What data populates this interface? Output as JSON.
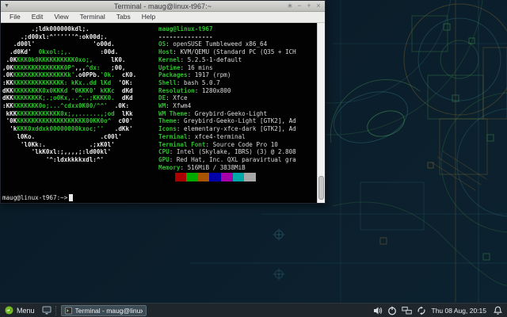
{
  "window": {
    "title": "Terminal - maug@linux-t967:~",
    "menu_items": [
      "File",
      "Edit",
      "View",
      "Terminal",
      "Tabs",
      "Help"
    ],
    "buttons": [
      {
        "name": "shade-button",
        "glyph": "∗"
      },
      {
        "name": "minimize-button",
        "glyph": "−"
      },
      {
        "name": "maximize-button",
        "glyph": "+"
      },
      {
        "name": "close-button",
        "glyph": "×"
      }
    ]
  },
  "terminal": {
    "ascii_art": [
      [
        [
          "w",
          "        .;ldk000000kdl;."
        ]
      ],
      [
        [
          "w",
          "     .;d00xl:^''''''^:ok00d;."
        ]
      ],
      [
        [
          "w",
          "   .d00l'                'o00d."
        ]
      ],
      [
        [
          "w",
          "  .d0Kd'"
        ],
        [
          "g",
          "  0kxol:;,."
        ],
        [
          "w",
          "        :00d."
        ]
      ],
      [
        [
          "w",
          " .0K"
        ],
        [
          "g",
          "KKK0k0KKKKKKKKKK0xo;,"
        ],
        [
          "w",
          "     lK0."
        ]
      ],
      [
        [
          "w",
          ",0K"
        ],
        [
          "g",
          "KKKKKKKKKKKKKK0P^"
        ],
        [
          "w",
          ",,,"
        ],
        [
          "g",
          "^dx:"
        ],
        [
          "w",
          "   ;00,"
        ]
      ],
      [
        [
          "w",
          ".0K"
        ],
        [
          "g",
          "KKKKKKKKKKKKKKKk'"
        ],
        [
          "w",
          ".o0PPb."
        ],
        [
          "g",
          "'0k."
        ],
        [
          "w",
          "  cK0."
        ]
      ],
      [
        [
          "w",
          ":KK"
        ],
        [
          "g",
          "KKKKKKKKKKKKKK: kKx..dd lKd"
        ],
        [
          "w",
          "  'OK:"
        ]
      ],
      [
        [
          "w",
          "dKK"
        ],
        [
          "g",
          "KKKKKKKK0x0KKKd ^0KKK0' kKKc"
        ],
        [
          "w",
          "  dKd"
        ]
      ],
      [
        [
          "w",
          "dKK"
        ],
        [
          "g",
          "KKKKKKKK;.;o0Kx,..^..;KKKK0."
        ],
        [
          "w",
          "  dKd"
        ]
      ],
      [
        [
          "w",
          ":KK"
        ],
        [
          "g",
          "KKKKKKK0o;...^cdxx0K00/^^'"
        ],
        [
          "w",
          "  .0K:"
        ]
      ],
      [
        [
          "w",
          " kKK"
        ],
        [
          "g",
          "KKKKKKKKKKKK0x;,,......,;od"
        ],
        [
          "w",
          "  lKk"
        ]
      ],
      [
        [
          "w",
          " '0K"
        ],
        [
          "g",
          "KKKKKKKKKKKKKKKKKKK00KK0o^"
        ],
        [
          "w",
          "  c00'"
        ]
      ],
      [
        [
          "w",
          "  'k"
        ],
        [
          "g",
          "KKK0xddxk00000000kxoc;''"
        ],
        [
          "w",
          "   .dKk'"
        ]
      ],
      [
        [
          "w",
          "    l0Ko.                  .c00l'"
        ]
      ],
      [
        [
          "w",
          "     'l0Kk:.            .;xK0l'"
        ]
      ],
      [
        [
          "w",
          "        'lkK0xl:;,,,,;:ld00kl'"
        ]
      ],
      [
        [
          "w",
          "            '^:ldxkkkkxdl:^'"
        ]
      ]
    ],
    "info": {
      "title": "maug@linux-t967",
      "underline": "---------------",
      "lines": [
        {
          "label": "OS",
          "value": "openSUSE Tumbleweed x86_64"
        },
        {
          "label": "Host",
          "value": "KVM/QEMU (Standard PC (Q35 + ICH"
        },
        {
          "label": "Kernel",
          "value": "5.2.5-1-default"
        },
        {
          "label": "Uptime",
          "value": "16 mins"
        },
        {
          "label": "Packages",
          "value": "1917 (rpm)"
        },
        {
          "label": "Shell",
          "value": "bash 5.0.7"
        },
        {
          "label": "Resolution",
          "value": "1280x800"
        },
        {
          "label": "DE",
          "value": "Xfce"
        },
        {
          "label": "WM",
          "value": "Xfwm4"
        },
        {
          "label": "WM Theme",
          "value": "Greybird-Geeko-Light"
        },
        {
          "label": "Theme",
          "value": "Greybird-Geeko-Light [GTK2], Ad"
        },
        {
          "label": "Icons",
          "value": "elementary-xfce-dark [GTK2], Ad"
        },
        {
          "label": "Terminal",
          "value": "xfce4-terminal"
        },
        {
          "label": "Terminal Font",
          "value": "Source Code Pro 10"
        },
        {
          "label": "CPU",
          "value": "Intel (Skylake, IBRS) (3) @ 2.808"
        },
        {
          "label": "GPU",
          "value": "Red Hat, Inc. QXL paravirtual gra"
        },
        {
          "label": "Memory",
          "value": "516MiB / 3838MiB"
        }
      ]
    },
    "palette": [
      "#000000",
      "#aa0000",
      "#00a800",
      "#a85400",
      "#0000a8",
      "#a800a8",
      "#00a8a8",
      "#a8a8a8"
    ],
    "prompt": "maug@linux-t967:~>"
  },
  "taskbar": {
    "menu_label": "Menu",
    "task_button_label": "Terminal - maug@linux...",
    "clock": "Thu 08 Aug, 20:15",
    "tray_icons": [
      "volume-icon",
      "power-manager-icon",
      "network-icon",
      "updates-icon"
    ]
  },
  "colors": {
    "terminal_green": "#2fbf2f",
    "terminal_fg": "#ededed",
    "titlebar": "#c9c9c6",
    "taskbar_bg": "#1f272d",
    "suse_green": "#73ba25"
  }
}
